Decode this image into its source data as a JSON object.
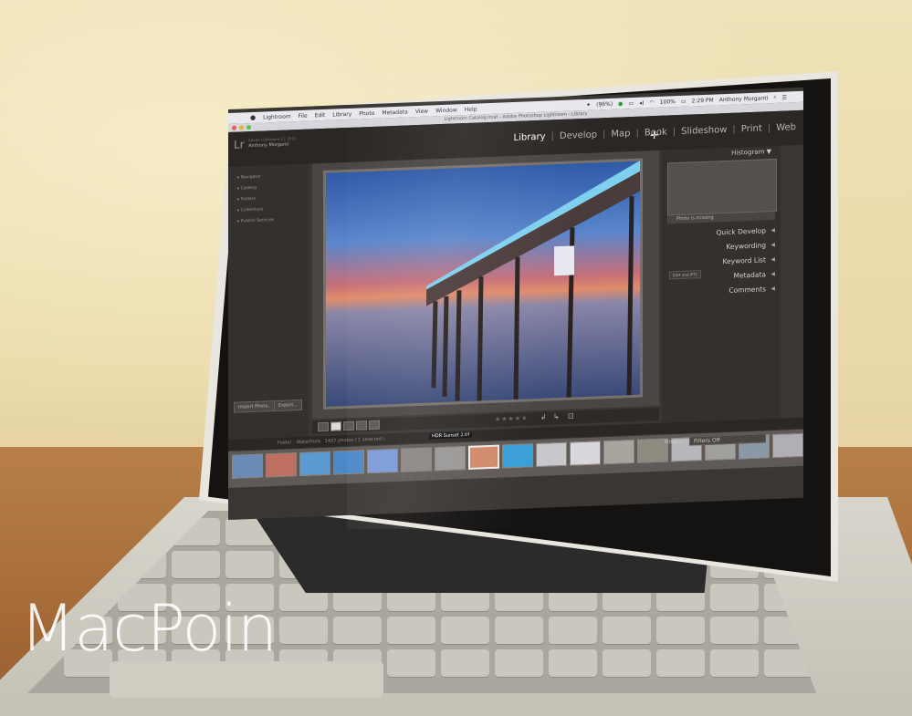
{
  "scene": {
    "description": "Photo of a MacBook Pro displaying Adobe Photoshop Lightroom Library module",
    "watermark": "MacPoin"
  },
  "menubar": {
    "apple": "",
    "app_name": "Lightroom",
    "menus": [
      "File",
      "Edit",
      "Library",
      "Photo",
      "Metadata",
      "View",
      "Window",
      "Help"
    ],
    "battery_percent": "100%",
    "battery_alt": "(96%)",
    "time": "2:29 PM",
    "user": "Anthony Morganti",
    "status_icons": [
      "dropbox-icon",
      "evernote-icon",
      "airplay-icon",
      "volume-icon",
      "wifi-icon",
      "battery-icon",
      "search-icon",
      "notification-icon"
    ]
  },
  "window": {
    "title": "Lightroom Catalog.lrcat - Adobe Photoshop Lightroom - Library"
  },
  "header": {
    "logo": "Lr",
    "caption": "Adobe Lightroom CC 2015",
    "user": "Anthony Morganti",
    "modules": [
      "Library",
      "Develop",
      "Map",
      "Book",
      "Slideshow",
      "Print",
      "Web"
    ],
    "active_module": "Library"
  },
  "left_panel": {
    "items": [
      "Navigator",
      "Catalog",
      "Folders",
      "Collections",
      "Publish Services"
    ]
  },
  "right_panel": {
    "histogram_title": "Histogram",
    "photo_missing": "Photo is missing",
    "items": [
      "Quick Develop",
      "Keywording",
      "Keyword List",
      "Metadata",
      "Comments"
    ],
    "metadata_preset": "EXIF and IPTC"
  },
  "bottom": {
    "import_label": "Import Photo...",
    "export_label": "Export...",
    "stars": "★★★★★",
    "filmstrip_source": "Folder : Waterfront",
    "filmstrip_count": "1437 photos / 1 selected /",
    "selected_file": "HDR Sunset 2.tif",
    "filter_label": "Filter :",
    "filter_value": "Filters Off"
  },
  "colors": {
    "lr_bg": "#3a3634",
    "panel": "#34302e",
    "accent_text": "#ffffff"
  }
}
